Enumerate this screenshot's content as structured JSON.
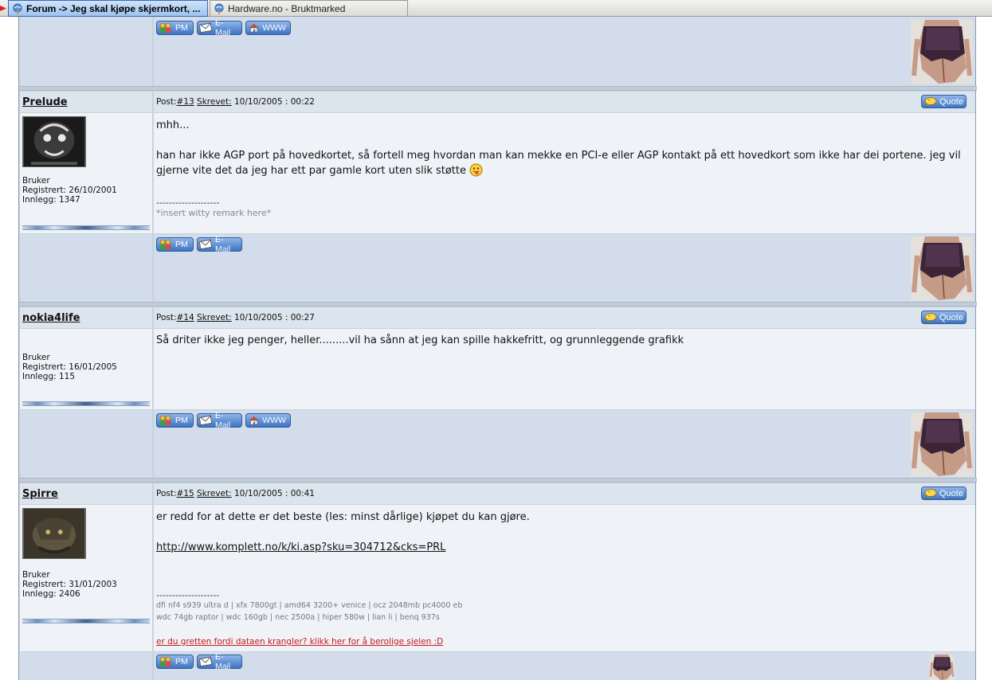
{
  "browser": {
    "tabs": [
      {
        "label": "Forum -> Jeg skal kjøpe skjermkort, ...",
        "active": true
      },
      {
        "label": "Hardware.no - Bruktmarked",
        "active": false
      }
    ]
  },
  "buttons": {
    "pm": "PM",
    "email": "E-Mail",
    "www": "WWW",
    "quote": "Quote"
  },
  "post_labels": {
    "post": "Post:",
    "written": "Skrevet:"
  },
  "posts": [
    {
      "username": "Prelude",
      "rank": "Bruker",
      "registered": "Registrert: 26/10/2001",
      "posts_count": "Innlegg: 1347",
      "post_no": "#13",
      "date": " 10/10/2005 : 00:22",
      "body": [
        "mhh...",
        "han har ikke AGP port på hovedkortet, så fortell meg hvordan man kan mekke en PCI-e eller AGP kontakt på ett hovedkort som ikke har dei portene. jeg vil gjerne vite det da jeg har ett par gamle kort uten slik støtte"
      ],
      "sig_line": "--------------------",
      "signature": "*insert witty remark here*"
    },
    {
      "username": "nokia4life",
      "rank": "Bruker",
      "registered": "Registrert: 16/01/2005",
      "posts_count": "Innlegg: 115",
      "post_no": "#14",
      "date": " 10/10/2005 : 00:27",
      "body": [
        "Så driter ikke jeg penger, heller.........vil ha sånn at jeg kan spille hakkefritt, og grunnleggende grafikk"
      ]
    },
    {
      "username": "Spirre",
      "rank": "Bruker",
      "registered": "Registrert: 31/01/2003",
      "posts_count": "Innlegg: 2406",
      "post_no": "#15",
      "date": " 10/10/2005 : 00:41",
      "body": [
        "er redd for at dette er det beste (les: minst dårlige) kjøpet du kan gjøre."
      ],
      "link": "http://www.komplett.no/k/ki.asp?sku=304712&cks=PRL",
      "sig_line": "--------------------",
      "sig_specs": [
        "dfi nf4 s939 ultra d | xfx 7800gt | amd64 3200+ venice | ocz 2048mb pc4000 eb",
        "wdc 74gb raptor | wdc 160gb | nec 2500a | hiper 580w | lian li | benq 937s"
      ],
      "sig_link": "er du gretten fordi dataen krangler? klikk her for å berolige sjelen :D"
    }
  ],
  "colors": {
    "accent": "#3e74c2",
    "row_light": "#eff3f8",
    "row_dark": "#d2dcea",
    "sig_link": "#c8171c"
  }
}
